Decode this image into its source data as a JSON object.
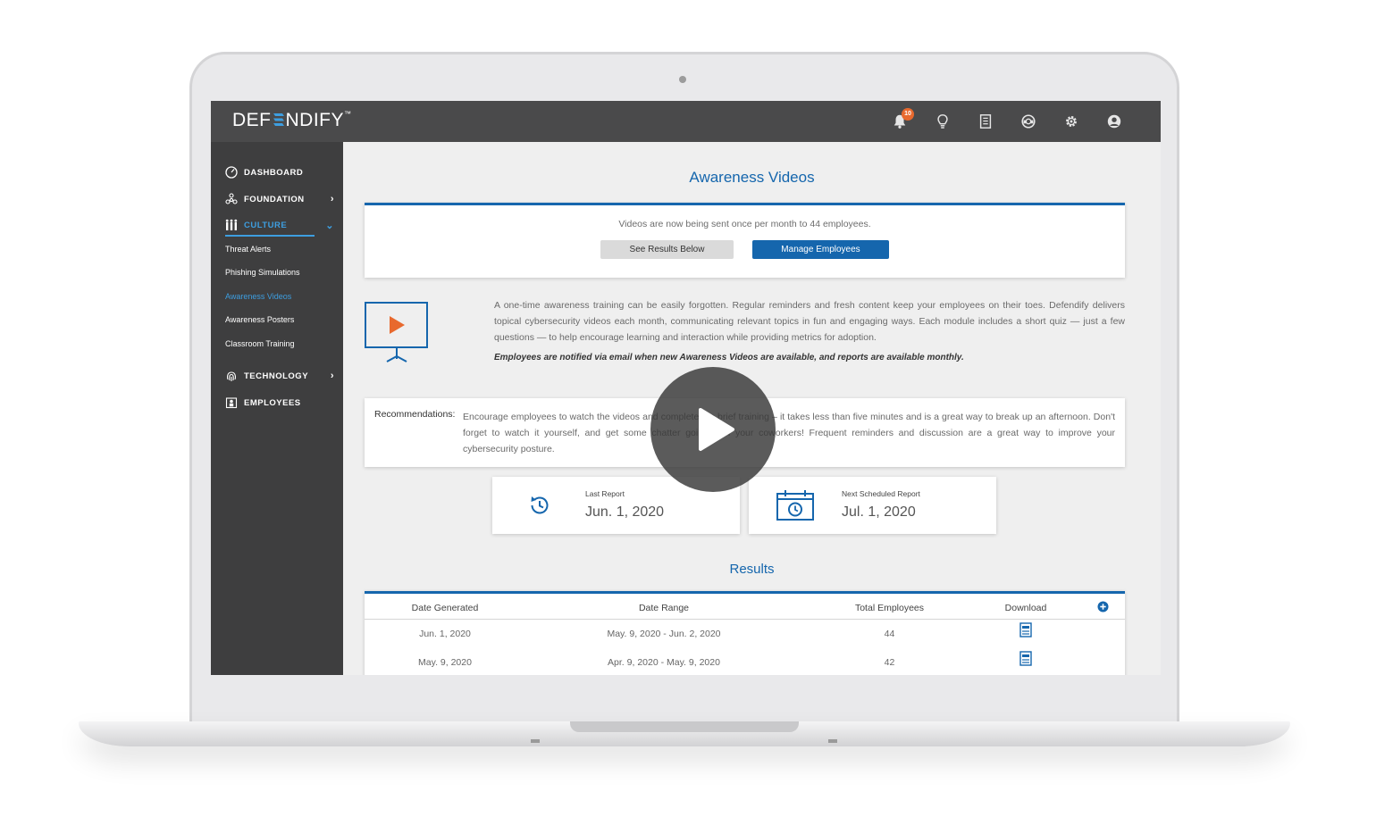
{
  "app": {
    "logo_text_left": "DEF",
    "logo_text_right": "NDIFY",
    "logo_tm": "™",
    "notification_count": "10"
  },
  "topbar_icons": [
    "bell-icon",
    "lightbulb-icon",
    "document-icon",
    "support-icon",
    "gear-icon",
    "user-icon"
  ],
  "sidebar": {
    "items": [
      {
        "label": "DASHBOARD",
        "icon": "gauge-icon"
      },
      {
        "label": "FOUNDATION",
        "icon": "network-icon"
      },
      {
        "label": "CULTURE",
        "icon": "people-icon"
      },
      {
        "label": "TECHNOLOGY",
        "icon": "fingerprint-icon"
      },
      {
        "label": "EMPLOYEES",
        "icon": "employees-icon"
      }
    ],
    "culture_sub": [
      "Threat Alerts",
      "Phishing Simulations",
      "Awareness Videos",
      "Awareness Posters",
      "Classroom Training"
    ]
  },
  "page": {
    "title": "Awareness Videos",
    "status": "Videos are now being sent once per month to 44 employees.",
    "btn_results": "See Results Below",
    "btn_manage": "Manage Employees",
    "description": "A one-time awareness training can be easily forgotten. Regular reminders and fresh content keep your employees on their toes. Defendify delivers topical cybersecurity videos each month, communicating relevant topics in fun and engaging ways. Each module includes a short quiz — just a few questions — to help encourage learning and interaction while providing metrics for adoption.",
    "notice": "Employees are notified via email when new Awareness Videos are available, and reports are available monthly.",
    "rec_label": "Recommendations:",
    "rec_text": "Encourage employees to watch the videos and complete the brief training – it takes less than five minutes and is a great way to break up an afternoon. Don't forget to watch it yourself, and get some chatter going with your coworkers! Frequent reminders and discussion are a great way to improve your cybersecurity posture."
  },
  "reports": {
    "last_label": "Last Report",
    "last_date": "Jun. 1, 2020",
    "next_label": "Next Scheduled Report",
    "next_date": "Jul. 1, 2020"
  },
  "results": {
    "title": "Results",
    "columns": [
      "Date Generated",
      "Date Range",
      "Total Employees",
      "Download"
    ],
    "rows": [
      {
        "generated": "Jun. 1, 2020",
        "range": "May. 9, 2020 - Jun. 2, 2020",
        "total": "44"
      },
      {
        "generated": "May. 9, 2020",
        "range": "Apr. 9, 2020 - May. 9, 2020",
        "total": "42"
      }
    ]
  },
  "colors": {
    "accent": "#1566ad",
    "badge": "#e8692e",
    "play_orange": "#e8692e"
  }
}
